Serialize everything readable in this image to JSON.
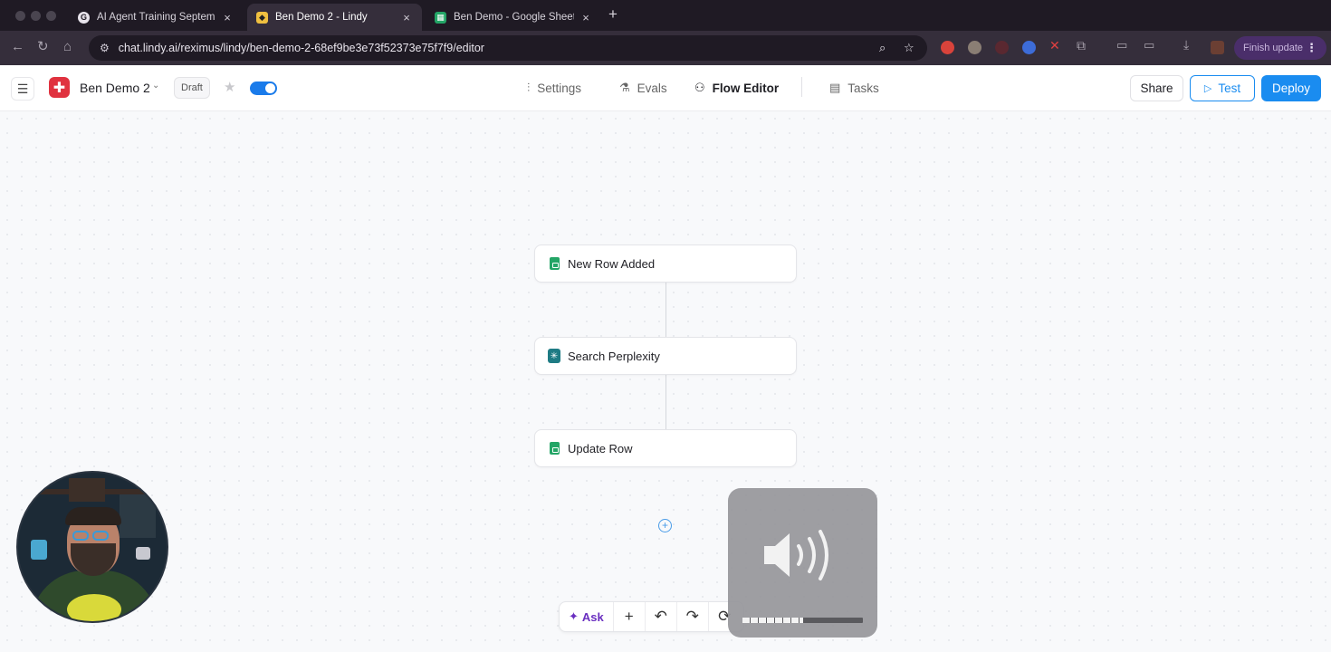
{
  "browser": {
    "tabs": [
      {
        "title": "AI Agent Training September",
        "favicon": "G",
        "color": "#e8e4ec",
        "active": false
      },
      {
        "title": "Ben Demo 2 - Lindy",
        "favicon": "◆",
        "color": "#f0c040",
        "active": true
      },
      {
        "title": "Ben Demo - Google Sheets",
        "favicon": "▦",
        "color": "#23a566",
        "active": false
      }
    ],
    "new_tab": "+",
    "url": "chat.lindy.ai/reximus/lindy/ben-demo-2-68ef9be3e73f52373e75f7f9/editor",
    "finish_update": "Finish update"
  },
  "header": {
    "agent_name": "Ben Demo 2",
    "status_badge": "Draft",
    "enabled": true,
    "nav": [
      {
        "label": "Settings",
        "icon": "sliders-icon",
        "active": false
      },
      {
        "label": "Evals",
        "icon": "flask-icon",
        "active": false
      },
      {
        "label": "Flow Editor",
        "icon": "flow-icon",
        "active": true
      },
      {
        "label": "Tasks",
        "icon": "clipboard-icon",
        "active": false
      }
    ],
    "share_label": "Share",
    "test_label": "Test",
    "deploy_label": "Deploy"
  },
  "flow": {
    "nodes": [
      {
        "label": "New Row Added",
        "icon": "google-sheets-trigger-icon"
      },
      {
        "label": "Search Perplexity",
        "icon": "perplexity-icon"
      },
      {
        "label": "Update Row",
        "icon": "google-sheets-icon"
      }
    ]
  },
  "bottom_toolbar": {
    "ask_label": "Ask"
  },
  "volume_hud": {
    "level": 0.5,
    "icon": "speaker-volume-icon"
  },
  "colors": {
    "accent": "#1a8cf0",
    "brand": "#e0323f",
    "ask": "#6a2fc0"
  }
}
